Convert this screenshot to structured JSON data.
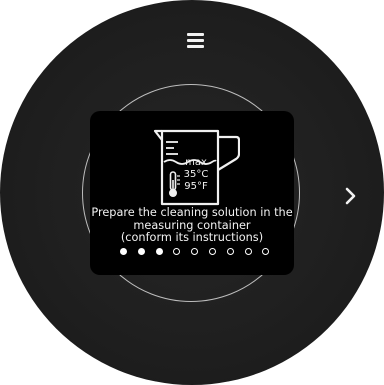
{
  "icons": {
    "menu": "hamburger-menu-icon",
    "next": "chevron-right-icon",
    "jug": "measuring-jug-icon",
    "thermometer": "thermometer-icon"
  },
  "jug_labels": {
    "max": "max",
    "celsius": "35°C",
    "fahrenheit": "95°F"
  },
  "instruction": {
    "line1": "Prepare the cleaning solution in the",
    "line2": "measuring container",
    "line3": "(conform its instructions)"
  },
  "pagination": {
    "total_steps": 9,
    "current_step": 3
  },
  "colors": {
    "screen_bg": "#000000",
    "device_bg": "#1f1f1f",
    "text": "#f2f2f2",
    "ring": "#bdbdbd"
  }
}
